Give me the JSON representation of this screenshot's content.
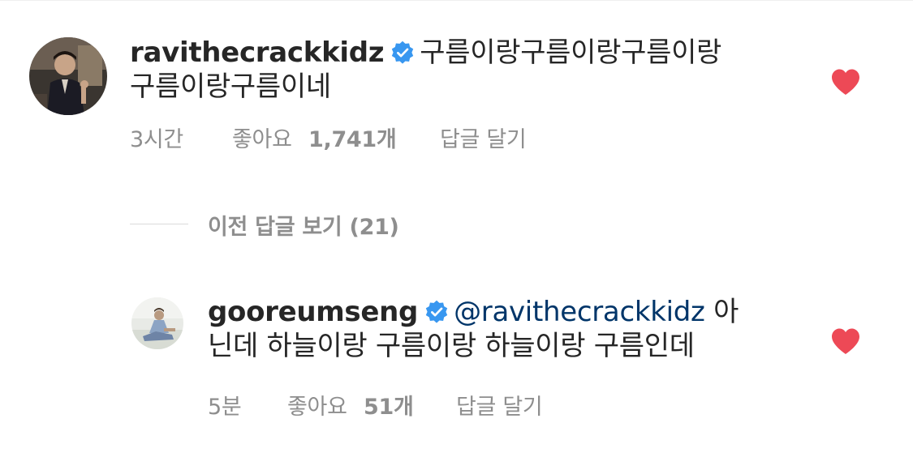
{
  "comments": [
    {
      "username": "ravithecrackkidz",
      "verified": true,
      "text": "구름이랑구름이랑구름이랑",
      "text_line2": "구름이랑구름이네",
      "time": "3시간",
      "likes_label": "좋아요",
      "likes_count": "1,741개",
      "reply_label": "답글 달기",
      "liked": true
    },
    {
      "username": "gooreumseng",
      "verified": true,
      "mention": "@ravithecrackkidz",
      "text": "아",
      "text_line2": "닌데 하늘이랑 구름이랑 하늘이랑 구름인데",
      "time": "5분",
      "likes_label": "좋아요",
      "likes_count": "51개",
      "reply_label": "답글 달기",
      "liked": true
    }
  ],
  "view_previous_replies": "이전 답글 보기 (21)",
  "colors": {
    "text": "#262626",
    "meta": "#8e8e8e",
    "heart": "#ed4956",
    "verified": "#3897f0",
    "mention": "#003569"
  }
}
